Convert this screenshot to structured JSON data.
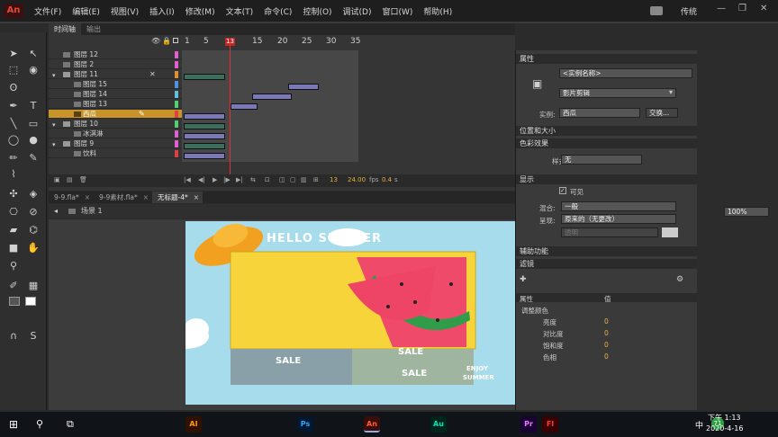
{
  "menubar": {
    "logo": "An",
    "items": [
      "文件(F)",
      "编辑(E)",
      "视图(V)",
      "插入(I)",
      "修改(M)",
      "文本(T)",
      "命令(C)",
      "控制(O)",
      "调试(D)",
      "窗口(W)",
      "帮助(H)"
    ],
    "workspace": "传统"
  },
  "timeline": {
    "tabs": [
      "时间轴",
      "输出"
    ],
    "frame_numbers": [
      "1",
      "5",
      "10",
      "15",
      "20",
      "25",
      "30",
      "35"
    ],
    "current_frame": "13",
    "layers": [
      {
        "name": "图层 12",
        "type": "layer"
      },
      {
        "name": "图层 2",
        "type": "layer"
      },
      {
        "name": "图层 11",
        "type": "folder"
      },
      {
        "name": "图层 15",
        "type": "sub"
      },
      {
        "name": "图层 14",
        "type": "sub"
      },
      {
        "name": "图层 13",
        "type": "sub"
      },
      {
        "name": "西瓜",
        "type": "selected"
      },
      {
        "name": "图层 10",
        "type": "folder"
      },
      {
        "name": "冰淇淋",
        "type": "sub"
      },
      {
        "name": "图层 9",
        "type": "folder"
      },
      {
        "name": "饮料",
        "type": "sub"
      }
    ],
    "status": {
      "frame": "13",
      "fps": "24.00",
      "fps_unit": "fps",
      "time": "0.4",
      "time_unit": "s"
    }
  },
  "doc_tabs": [
    "9-9.fla*",
    "9-9素材.fla*",
    "无标题-4*"
  ],
  "edit_bar": {
    "scene": "场景 1",
    "zoom": "100%"
  },
  "stage": {
    "headline": "HELLO SUMMER",
    "sale_labels": [
      "SALE",
      "SALE",
      "SALE",
      "SALE"
    ],
    "badge": [
      "ENJOY",
      "SUMMER"
    ]
  },
  "properties": {
    "tab": "属性",
    "instance_name_placeholder": "<实例名称>",
    "symbol_type": "影片剪辑",
    "instance_label": "实例:",
    "instance_value": "西瓜",
    "swap_button": "交换...",
    "sections": {
      "position": "位置和大小",
      "color_effect": "色彩效果",
      "display": "显示",
      "accessibility": "辅助功能",
      "filters": "滤镜"
    },
    "style_label": "样式:",
    "style_value": "无",
    "visible_label": "可见",
    "blend_label": "混合:",
    "blend_value": "一般",
    "render_label": "呈现:",
    "render_value": "原来的（无更改）",
    "transparent_value": "透明",
    "filter_table": {
      "headers": [
        "属性",
        "值"
      ],
      "group": "调整颜色",
      "rows": [
        {
          "name": "亮度",
          "value": "0"
        },
        {
          "name": "对比度",
          "value": "0"
        },
        {
          "name": "饱和度",
          "value": "0"
        },
        {
          "name": "色相",
          "value": "0"
        }
      ]
    }
  },
  "taskbar": {
    "time": "下午 1:13",
    "date": "2020-4-16",
    "ime": "中",
    "badge": "71",
    "apps": [
      "AI",
      "Ps",
      "Au",
      "Pr",
      "An",
      "Fl"
    ]
  },
  "colors": {
    "playhead": "#e03030",
    "selected_layer": "#c8942a",
    "tween": "#7b78b8",
    "stage_bg": "#a7dcec",
    "banner": "#f6d43a"
  }
}
